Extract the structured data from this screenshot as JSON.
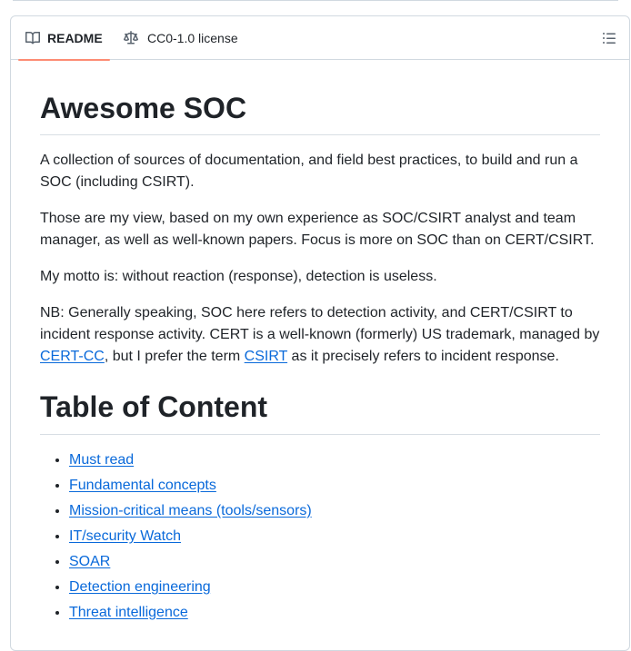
{
  "tabs": {
    "readme": "README",
    "license": "CC0-1.0 license"
  },
  "heading1": "Awesome SOC",
  "intro": "A collection of sources of documentation, and field best practices, to build and run a SOC (including CSIRT).",
  "view": "Those are my view, based on my own experience as SOC/CSIRT analyst and team manager, as well as well-known papers. Focus is more on SOC than on CERT/CSIRT.",
  "motto": "My motto is: without reaction (response), detection is useless.",
  "nb": {
    "part1": "NB: Generally speaking, SOC here refers to detection activity, and CERT/CSIRT to incident response activity. CERT is a well-known (formerly) US trademark, managed by ",
    "link1": "CERT-CC",
    "part2": ", but I prefer the term ",
    "link2": "CSIRT",
    "part3": " as it precisely refers to incident response."
  },
  "heading2": "Table of Content",
  "toc": [
    "Must read",
    "Fundamental concepts",
    "Mission-critical means (tools/sensors)",
    "IT/security Watch",
    "SOAR",
    "Detection engineering",
    "Threat intelligence"
  ],
  "colors": {
    "link": "#0969da",
    "tab_underline": "#fd8c73",
    "border": "#d1d9e0"
  }
}
